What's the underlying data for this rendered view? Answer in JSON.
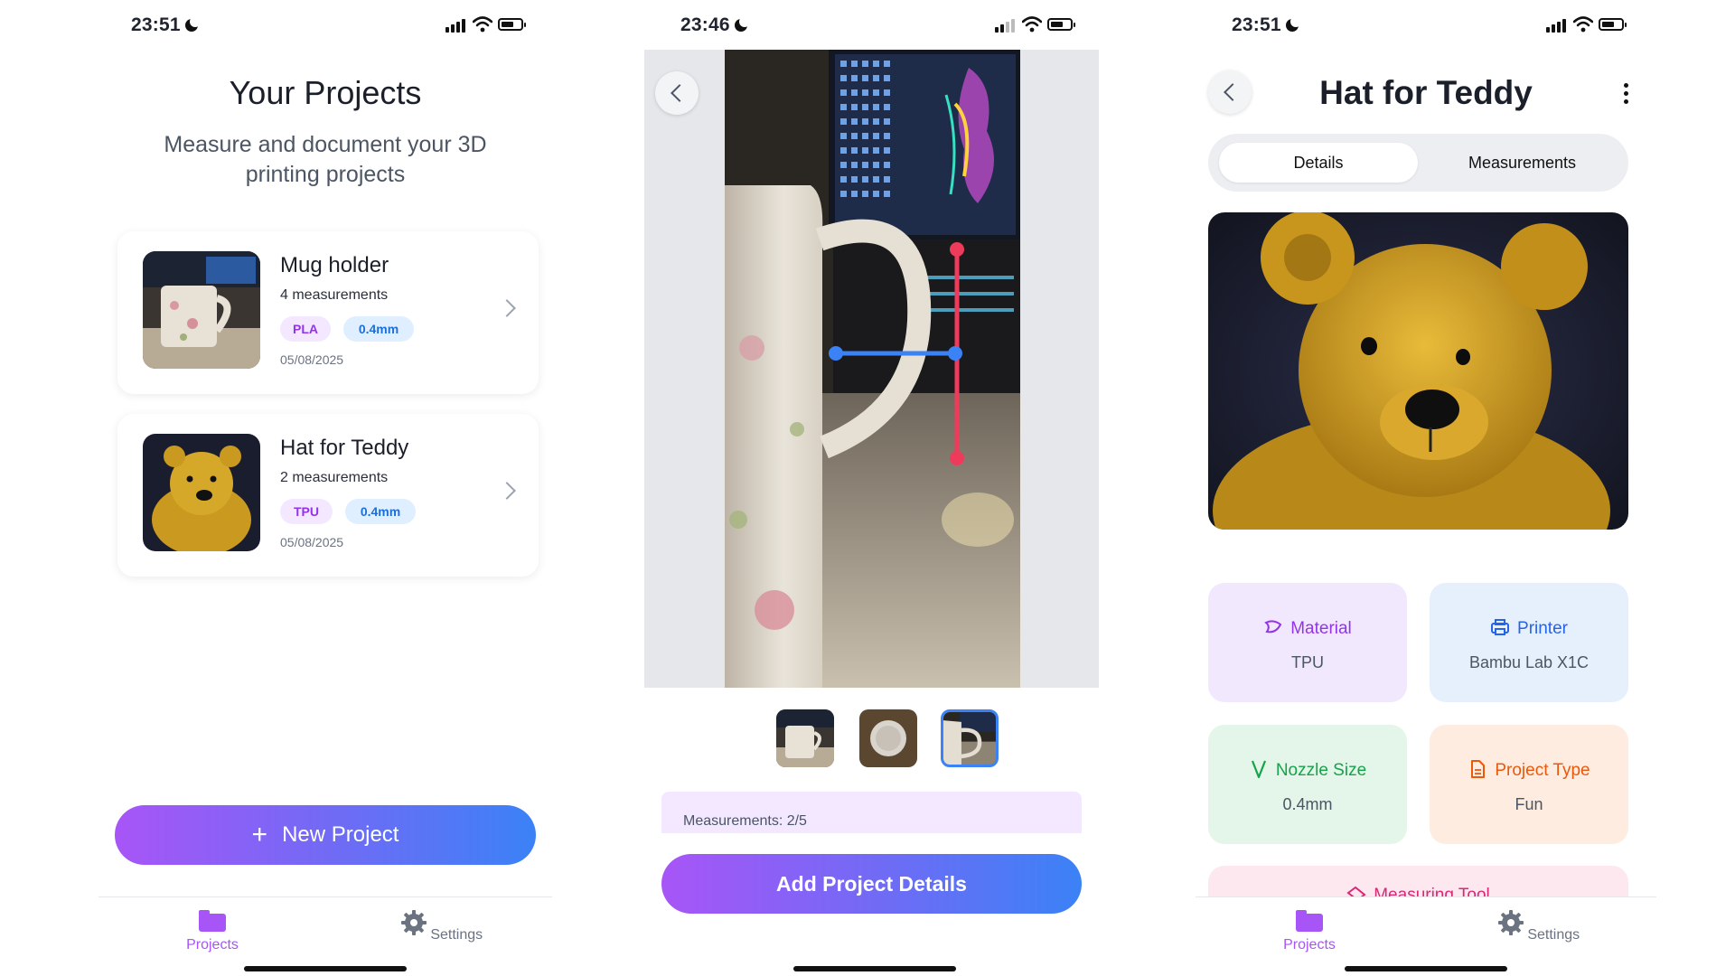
{
  "screens": {
    "projects": {
      "time": "23:51",
      "title": "Your Projects",
      "subtitle": "Measure and document your 3D printing projects",
      "projects": [
        {
          "name": "Mug holder",
          "measurements": "4 measurements",
          "material": "PLA",
          "nozzle": "0.4mm",
          "date": "05/08/2025"
        },
        {
          "name": "Hat for Teddy",
          "measurements": "2 measurements",
          "material": "TPU",
          "nozzle": "0.4mm",
          "date": "05/08/2025"
        }
      ],
      "new_project_label": "New Project",
      "tabs": {
        "projects": "Projects",
        "settings": "Settings"
      }
    },
    "measure": {
      "time": "23:46",
      "measurements_label": "Measurements: 2/5",
      "add_details_label": "Add Project Details"
    },
    "detail": {
      "time": "23:51",
      "title": "Hat for Teddy",
      "segments": {
        "details": "Details",
        "measurements": "Measurements"
      },
      "info": {
        "material": {
          "label": "Material",
          "value": "TPU"
        },
        "printer": {
          "label": "Printer",
          "value": "Bambu Lab X1C"
        },
        "nozzle": {
          "label": "Nozzle Size",
          "value": "0.4mm"
        },
        "type": {
          "label": "Project Type",
          "value": "Fun"
        },
        "tool": {
          "label": "Measuring Tool"
        }
      },
      "tabs": {
        "projects": "Projects",
        "settings": "Settings"
      }
    }
  },
  "colors": {
    "accent_purple": "#a855f7",
    "accent_blue": "#3b82f6",
    "measure_red": "#ef3b5b",
    "measure_blue": "#3b82f6"
  },
  "icons": [
    "moon-icon",
    "cellular-signal-icon",
    "wifi-icon",
    "battery-icon",
    "chevron-right-icon",
    "plus-icon",
    "folder-icon",
    "gear-icon",
    "back-arrow-icon",
    "more-vertical-icon",
    "material-icon",
    "printer-icon",
    "nozzle-icon",
    "document-icon",
    "ruler-icon"
  ]
}
